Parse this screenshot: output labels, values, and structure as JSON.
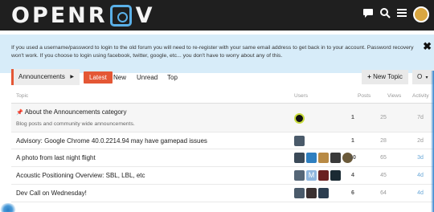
{
  "header": {
    "logo_text": "OPENR",
    "logo_tail": "V",
    "icons": [
      "chat-bubble-icon",
      "search-icon",
      "hamburger-menu-icon"
    ]
  },
  "notice": {
    "text": "If you used a username/password to login to the old forum you will need to re-register with your same email address to get back in to your account. Password recovery won't work. If you choose to login using facebook, twitter, google, etc... you don't have to worry about any of this.",
    "close_label": "✖"
  },
  "navigation": {
    "category": "Announcements",
    "tabs": [
      "Latest",
      "New",
      "Unread",
      "Top"
    ],
    "active_tab": "Latest",
    "new_topic_label": "New Topic",
    "notification_label": "O",
    "accent_color": "#e45735"
  },
  "table": {
    "columns": {
      "topic": "Topic",
      "users": "Users",
      "posts": "Posts",
      "views": "Views",
      "activity": "Activity"
    },
    "rows": [
      {
        "title": "About the Announcements category",
        "excerpt": "Blog posts and community wide announcements.",
        "pinned": true,
        "avatars": [
          "#1a1a1a"
        ],
        "posts": "1",
        "views": "25",
        "activity": "7d"
      },
      {
        "title": "Advisory: Google Chrome 40.0.2214.94 may have gamepad issues",
        "avatars": [
          "#4a5a6a"
        ],
        "posts": "1",
        "views": "28",
        "activity": "2d"
      },
      {
        "title": "A photo from last night flight",
        "avatars": [
          "#3b4a58",
          "#2f7fc0",
          "#b88a45",
          "#3a3a3a",
          "#6b5a3a"
        ],
        "posts": "10",
        "views": "65",
        "activity": "3d"
      },
      {
        "title": "Acoustic Positioning Overview: SBL, LBL, etc",
        "avatars": [
          "#556677",
          "#8fb6de",
          "#6a2020",
          "#1a2a33"
        ],
        "posts": "4",
        "views": "45",
        "activity": "4d"
      },
      {
        "title": "Dev Call on Wednesday!",
        "avatars": [
          "#4a5a6a",
          "#3a3030",
          "#2c3e50"
        ],
        "posts": "6",
        "views": "64",
        "activity": "4d"
      }
    ]
  }
}
